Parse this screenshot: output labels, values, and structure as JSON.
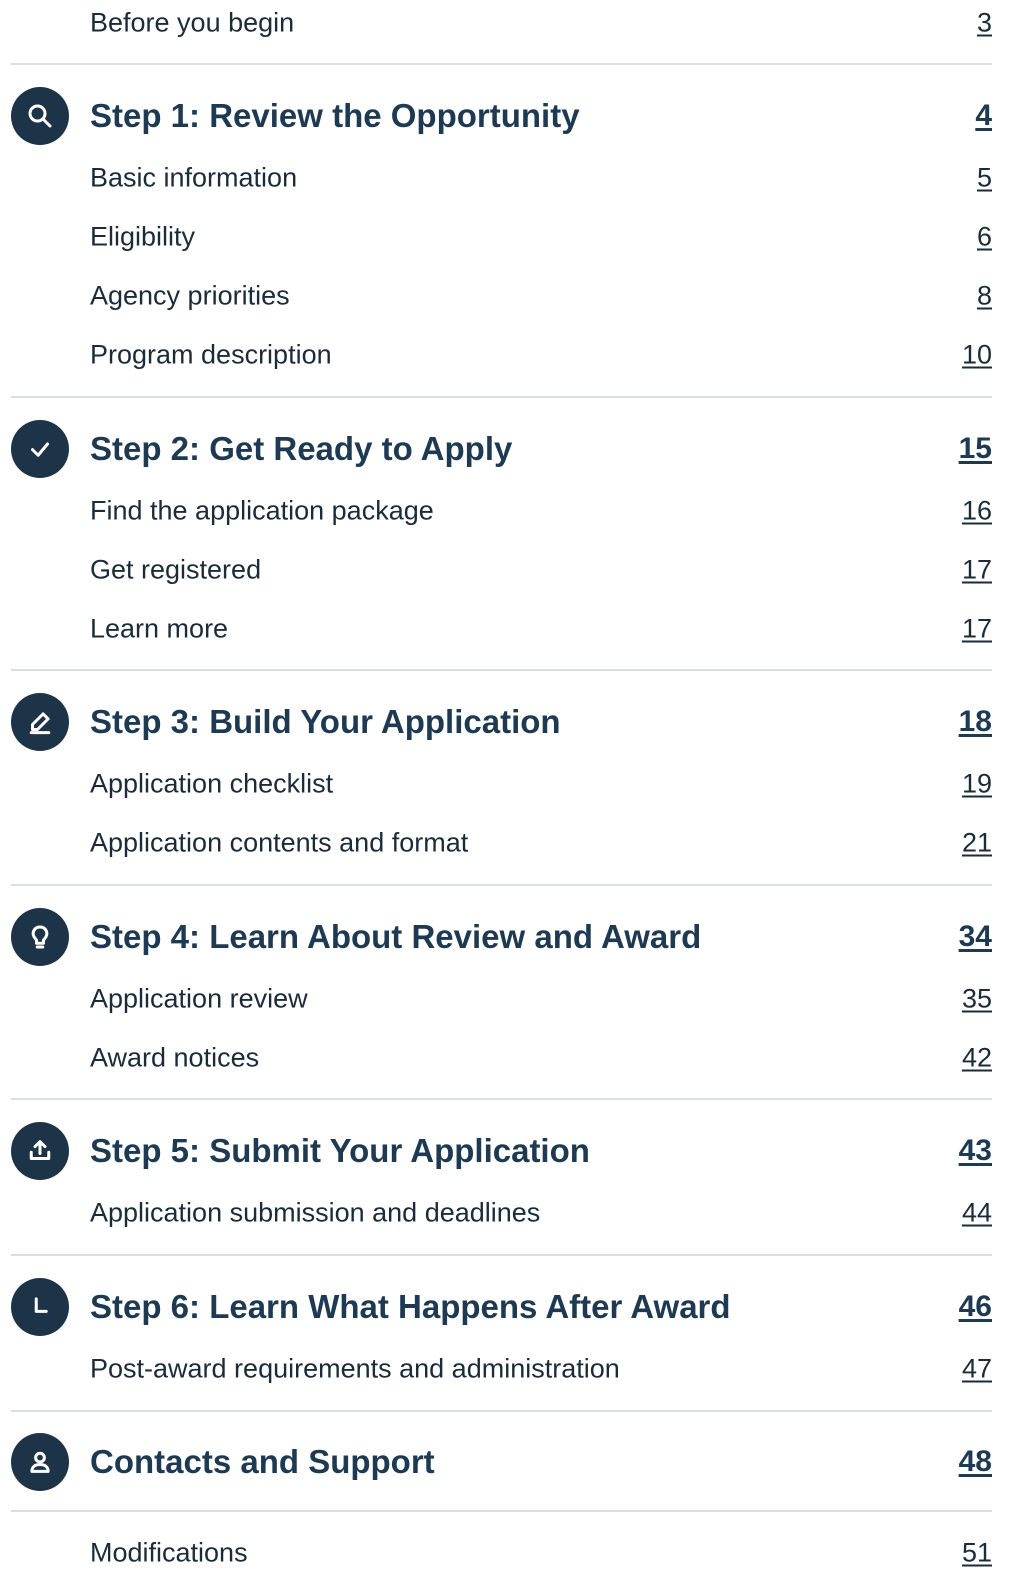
{
  "toc": {
    "intro": {
      "label": "Before you begin",
      "page": "3"
    },
    "step1": {
      "title": "Step 1: Review the Opportunity",
      "page": "4",
      "icon": "search-icon",
      "items": [
        {
          "label": "Basic information",
          "page": "5"
        },
        {
          "label": "Eligibility",
          "page": "6"
        },
        {
          "label": "Agency priorities",
          "page": "8"
        },
        {
          "label": "Program description",
          "page": "10"
        }
      ]
    },
    "step2": {
      "title": "Step 2: Get Ready to Apply",
      "page": "15",
      "icon": "check-icon",
      "items": [
        {
          "label": "Find the application package",
          "page": "16"
        },
        {
          "label": "Get registered",
          "page": "17"
        },
        {
          "label": "Learn more",
          "page": "17"
        }
      ]
    },
    "step3": {
      "title": "Step 3: Build Your Application",
      "page": "18",
      "icon": "pencil-icon",
      "items": [
        {
          "label": "Application checklist",
          "page": "19"
        },
        {
          "label": "Application contents and format",
          "page": "21"
        }
      ]
    },
    "step4": {
      "title": "Step 4: Learn About Review and Award",
      "page": "34",
      "icon": "lightbulb-icon",
      "items": [
        {
          "label": "Application review",
          "page": "35"
        },
        {
          "label": "Award notices",
          "page": "42"
        }
      ]
    },
    "step5": {
      "title": "Step 5: Submit Your Application",
      "page": "43",
      "icon": "upload-icon",
      "items": [
        {
          "label": "Application submission and deadlines",
          "page": "44"
        }
      ]
    },
    "step6": {
      "title": "Step 6: Learn What Happens After Award",
      "page": "46",
      "icon": "clock-icon",
      "items": [
        {
          "label": "Post-award requirements and administration",
          "page": "47"
        }
      ]
    },
    "contacts": {
      "title": "Contacts and Support",
      "page": "48",
      "icon": "person-icon"
    },
    "modifications": {
      "label": "Modifications",
      "page": "51"
    }
  },
  "colors": {
    "heading": "#1e3a52",
    "icon_bg": "#1d3448",
    "divider": "#d9dee3",
    "text": "#1b2b3a"
  }
}
